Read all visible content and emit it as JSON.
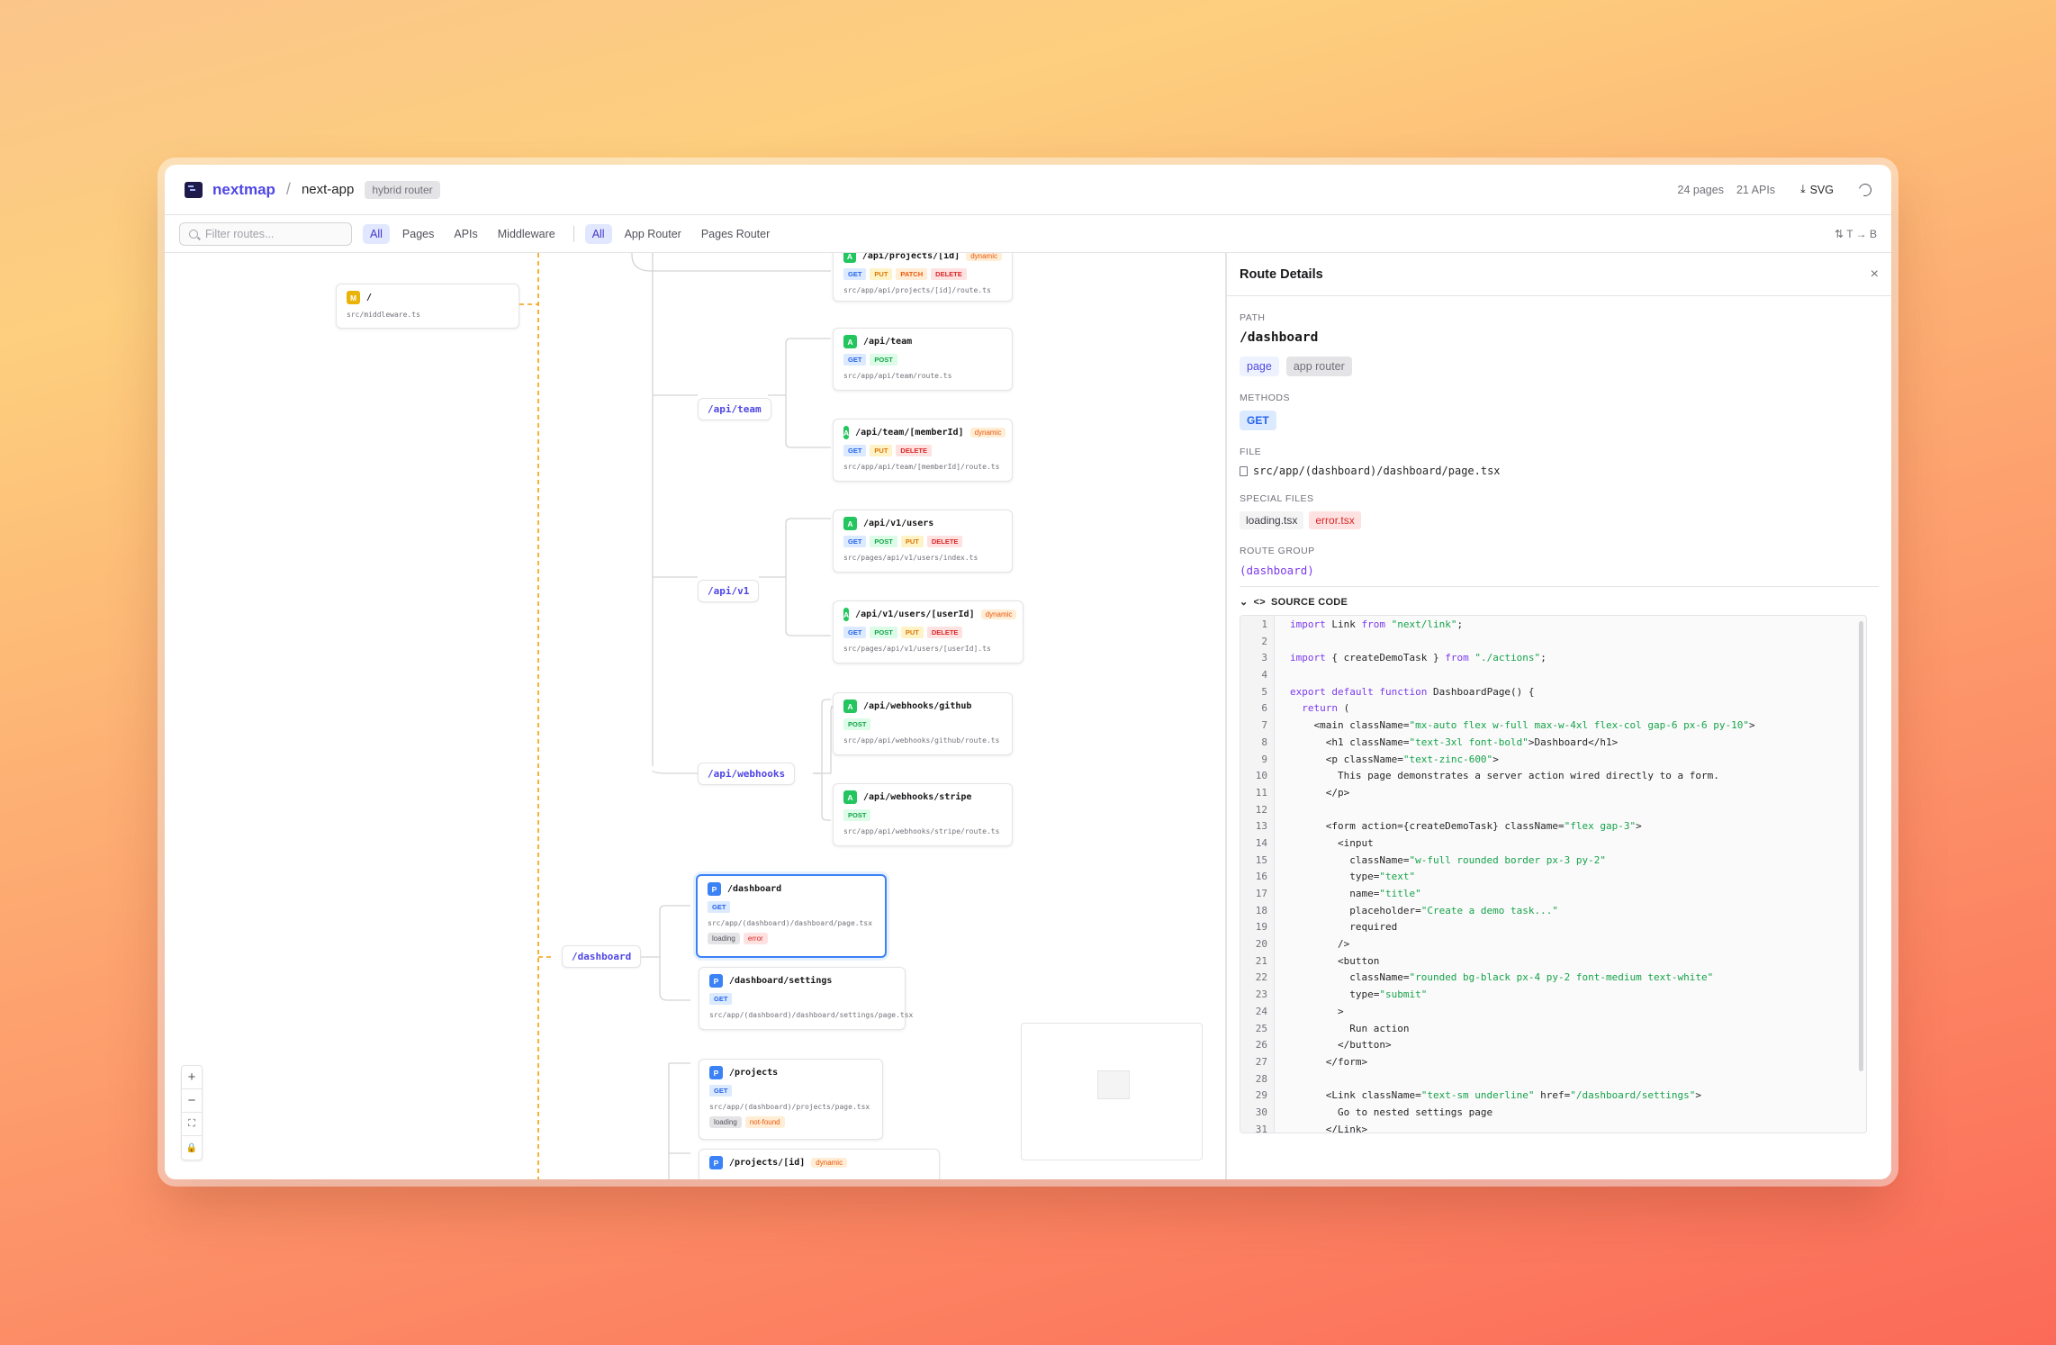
{
  "app": {
    "brand": "nextmap",
    "separator": "/",
    "project": "next-app",
    "router_badge": "hybrid router"
  },
  "stats": {
    "pages": "24 pages",
    "apis": "21 APIs",
    "export_label": "SVG"
  },
  "filters": {
    "search_placeholder": "Filter routes...",
    "type_tabs": [
      "All",
      "Pages",
      "APIs",
      "Middleware"
    ],
    "router_tabs": [
      "All",
      "App Router",
      "Pages Router"
    ],
    "layout_toggle": "T → B"
  },
  "canvas": {
    "middleware": {
      "type": "M",
      "path": "/",
      "file": "src/middleware.ts"
    },
    "groups": [
      "/api/team",
      "/api/v1",
      "/api/webhooks",
      "/dashboard"
    ],
    "nodes": [
      {
        "type": "A",
        "path": "/api/projects/[id]",
        "dynamic": "dynamic",
        "methods": [
          "GET",
          "PUT",
          "PATCH",
          "DELETE"
        ],
        "file": "src/app/api/projects/[id]/route.ts"
      },
      {
        "type": "A",
        "path": "/api/team",
        "methods": [
          "GET",
          "POST"
        ],
        "file": "src/app/api/team/route.ts"
      },
      {
        "type": "A",
        "path": "/api/team/[memberId]",
        "dynamic": "dynamic",
        "methods": [
          "GET",
          "PUT",
          "DELETE"
        ],
        "file": "src/app/api/team/[memberId]/route.ts"
      },
      {
        "type": "A",
        "path": "/api/v1/users",
        "methods": [
          "GET",
          "POST",
          "PUT",
          "DELETE"
        ],
        "file": "src/pages/api/v1/users/index.ts"
      },
      {
        "type": "A",
        "path": "/api/v1/users/[userId]",
        "dynamic": "dynamic",
        "methods": [
          "GET",
          "POST",
          "PUT",
          "DELETE"
        ],
        "file": "src/pages/api/v1/users/[userId].ts"
      },
      {
        "type": "A",
        "path": "/api/webhooks/github",
        "methods": [
          "POST"
        ],
        "file": "src/app/api/webhooks/github/route.ts"
      },
      {
        "type": "A",
        "path": "/api/webhooks/stripe",
        "methods": [
          "POST"
        ],
        "file": "src/app/api/webhooks/stripe/route.ts"
      },
      {
        "type": "P",
        "path": "/dashboard",
        "methods": [
          "GET"
        ],
        "file": "src/app/(dashboard)/dashboard/page.tsx",
        "special": [
          "loading",
          "error"
        ],
        "selected": true
      },
      {
        "type": "P",
        "path": "/dashboard/settings",
        "methods": [
          "GET"
        ],
        "file": "src/app/(dashboard)/dashboard/settings/page.tsx"
      },
      {
        "type": "P",
        "path": "/projects",
        "methods": [
          "GET"
        ],
        "file": "src/app/(dashboard)/projects/page.tsx",
        "special": [
          "loading",
          "not-found"
        ]
      },
      {
        "type": "P",
        "path": "/projects/[id]",
        "dynamic": "dynamic",
        "methods": [],
        "file": ""
      }
    ],
    "zoom_controls": [
      "+",
      "−",
      "⛶",
      "🔒"
    ]
  },
  "details": {
    "title": "Route Details",
    "close": "×",
    "path_label": "PATH",
    "path": "/dashboard",
    "kind_tags": [
      "page",
      "app router"
    ],
    "methods_label": "METHODS",
    "methods": [
      "GET"
    ],
    "file_label": "FILE",
    "file": "src/app/(dashboard)/dashboard/page.tsx",
    "special_label": "SPECIAL FILES",
    "special_files": [
      "loading.tsx",
      "error.tsx"
    ],
    "group_label": "ROUTE GROUP",
    "group": "(dashboard)",
    "source_label": "SOURCE CODE",
    "source_lines": [
      "import Link from \"next/link\";",
      "",
      "import { createDemoTask } from \"./actions\";",
      "",
      "export default function DashboardPage() {",
      "  return (",
      "    <main className=\"mx-auto flex w-full max-w-4xl flex-col gap-6 px-6 py-10\">",
      "      <h1 className=\"text-3xl font-bold\">Dashboard</h1>",
      "      <p className=\"text-zinc-600\">",
      "        This page demonstrates a server action wired directly to a form.",
      "      </p>",
      "",
      "      <form action={createDemoTask} className=\"flex gap-3\">",
      "        <input",
      "          className=\"w-full rounded border px-3 py-2\"",
      "          type=\"text\"",
      "          name=\"title\"",
      "          placeholder=\"Create a demo task...\"",
      "          required",
      "        />",
      "        <button",
      "          className=\"rounded bg-black px-4 py-2 font-medium text-white\"",
      "          type=\"submit\"",
      "        >",
      "          Run action",
      "        </button>",
      "      </form>",
      "",
      "      <Link className=\"text-sm underline\" href=\"/dashboard/settings\">",
      "        Go to nested settings page",
      "      </Link>"
    ]
  },
  "colors": {
    "accent": "#4f46e5",
    "selected_border": "#3b82f6",
    "middleware_edge": "#f59e0b",
    "code_string": "#16a34a",
    "code_keyword": "#7c3aed"
  }
}
